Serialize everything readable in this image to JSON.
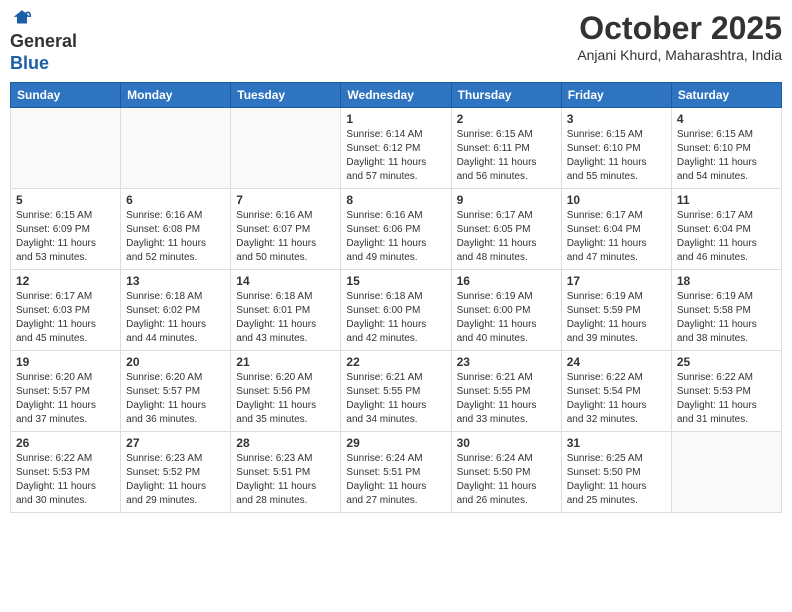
{
  "header": {
    "logo_general": "General",
    "logo_blue": "Blue",
    "month": "October 2025",
    "location": "Anjani Khurd, Maharashtra, India"
  },
  "weekdays": [
    "Sunday",
    "Monday",
    "Tuesday",
    "Wednesday",
    "Thursday",
    "Friday",
    "Saturday"
  ],
  "weeks": [
    [
      {
        "day": "",
        "info": ""
      },
      {
        "day": "",
        "info": ""
      },
      {
        "day": "",
        "info": ""
      },
      {
        "day": "1",
        "info": "Sunrise: 6:14 AM\nSunset: 6:12 PM\nDaylight: 11 hours and 57 minutes."
      },
      {
        "day": "2",
        "info": "Sunrise: 6:15 AM\nSunset: 6:11 PM\nDaylight: 11 hours and 56 minutes."
      },
      {
        "day": "3",
        "info": "Sunrise: 6:15 AM\nSunset: 6:10 PM\nDaylight: 11 hours and 55 minutes."
      },
      {
        "day": "4",
        "info": "Sunrise: 6:15 AM\nSunset: 6:10 PM\nDaylight: 11 hours and 54 minutes."
      }
    ],
    [
      {
        "day": "5",
        "info": "Sunrise: 6:15 AM\nSunset: 6:09 PM\nDaylight: 11 hours and 53 minutes."
      },
      {
        "day": "6",
        "info": "Sunrise: 6:16 AM\nSunset: 6:08 PM\nDaylight: 11 hours and 52 minutes."
      },
      {
        "day": "7",
        "info": "Sunrise: 6:16 AM\nSunset: 6:07 PM\nDaylight: 11 hours and 50 minutes."
      },
      {
        "day": "8",
        "info": "Sunrise: 6:16 AM\nSunset: 6:06 PM\nDaylight: 11 hours and 49 minutes."
      },
      {
        "day": "9",
        "info": "Sunrise: 6:17 AM\nSunset: 6:05 PM\nDaylight: 11 hours and 48 minutes."
      },
      {
        "day": "10",
        "info": "Sunrise: 6:17 AM\nSunset: 6:04 PM\nDaylight: 11 hours and 47 minutes."
      },
      {
        "day": "11",
        "info": "Sunrise: 6:17 AM\nSunset: 6:04 PM\nDaylight: 11 hours and 46 minutes."
      }
    ],
    [
      {
        "day": "12",
        "info": "Sunrise: 6:17 AM\nSunset: 6:03 PM\nDaylight: 11 hours and 45 minutes."
      },
      {
        "day": "13",
        "info": "Sunrise: 6:18 AM\nSunset: 6:02 PM\nDaylight: 11 hours and 44 minutes."
      },
      {
        "day": "14",
        "info": "Sunrise: 6:18 AM\nSunset: 6:01 PM\nDaylight: 11 hours and 43 minutes."
      },
      {
        "day": "15",
        "info": "Sunrise: 6:18 AM\nSunset: 6:00 PM\nDaylight: 11 hours and 42 minutes."
      },
      {
        "day": "16",
        "info": "Sunrise: 6:19 AM\nSunset: 6:00 PM\nDaylight: 11 hours and 40 minutes."
      },
      {
        "day": "17",
        "info": "Sunrise: 6:19 AM\nSunset: 5:59 PM\nDaylight: 11 hours and 39 minutes."
      },
      {
        "day": "18",
        "info": "Sunrise: 6:19 AM\nSunset: 5:58 PM\nDaylight: 11 hours and 38 minutes."
      }
    ],
    [
      {
        "day": "19",
        "info": "Sunrise: 6:20 AM\nSunset: 5:57 PM\nDaylight: 11 hours and 37 minutes."
      },
      {
        "day": "20",
        "info": "Sunrise: 6:20 AM\nSunset: 5:57 PM\nDaylight: 11 hours and 36 minutes."
      },
      {
        "day": "21",
        "info": "Sunrise: 6:20 AM\nSunset: 5:56 PM\nDaylight: 11 hours and 35 minutes."
      },
      {
        "day": "22",
        "info": "Sunrise: 6:21 AM\nSunset: 5:55 PM\nDaylight: 11 hours and 34 minutes."
      },
      {
        "day": "23",
        "info": "Sunrise: 6:21 AM\nSunset: 5:55 PM\nDaylight: 11 hours and 33 minutes."
      },
      {
        "day": "24",
        "info": "Sunrise: 6:22 AM\nSunset: 5:54 PM\nDaylight: 11 hours and 32 minutes."
      },
      {
        "day": "25",
        "info": "Sunrise: 6:22 AM\nSunset: 5:53 PM\nDaylight: 11 hours and 31 minutes."
      }
    ],
    [
      {
        "day": "26",
        "info": "Sunrise: 6:22 AM\nSunset: 5:53 PM\nDaylight: 11 hours and 30 minutes."
      },
      {
        "day": "27",
        "info": "Sunrise: 6:23 AM\nSunset: 5:52 PM\nDaylight: 11 hours and 29 minutes."
      },
      {
        "day": "28",
        "info": "Sunrise: 6:23 AM\nSunset: 5:51 PM\nDaylight: 11 hours and 28 minutes."
      },
      {
        "day": "29",
        "info": "Sunrise: 6:24 AM\nSunset: 5:51 PM\nDaylight: 11 hours and 27 minutes."
      },
      {
        "day": "30",
        "info": "Sunrise: 6:24 AM\nSunset: 5:50 PM\nDaylight: 11 hours and 26 minutes."
      },
      {
        "day": "31",
        "info": "Sunrise: 6:25 AM\nSunset: 5:50 PM\nDaylight: 11 hours and 25 minutes."
      },
      {
        "day": "",
        "info": ""
      }
    ]
  ]
}
